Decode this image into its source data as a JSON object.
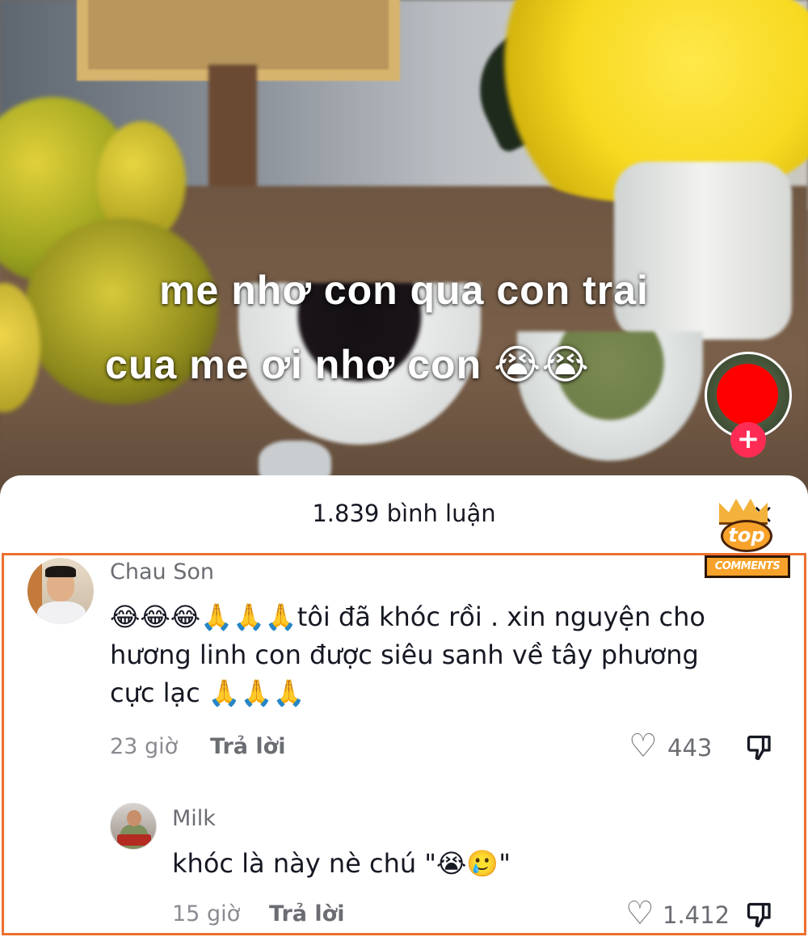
{
  "video": {
    "caption_line1": "me nhơ con qua con trai",
    "caption_line2": "cua me ơi  nhơ con 😭😭",
    "follow_symbol": "+"
  },
  "comments_panel": {
    "title": "1.839 bình luận",
    "close_symbol": "×"
  },
  "badge": {
    "top": "top",
    "comments": "COMMENTS"
  },
  "comments": [
    {
      "username": "Chau Son",
      "text": "😂😂😂🙏🙏🙏tôi đã khóc rồi . xin nguyện cho hương linh con được siêu sanh về tây phương cực lạc 🙏🙏🙏",
      "time": "23 giờ",
      "reply_label": "Trả lời",
      "likes": "443"
    },
    {
      "username": "Milk",
      "text": "khóc là này nè chú \"😭🥲\"",
      "time": "15 giờ",
      "reply_label": "Trả lời",
      "likes": "1.412"
    }
  ],
  "icons": {
    "like": "heart-outline-icon",
    "dislike": "thumbs-down-icon",
    "follow": "plus-icon",
    "close": "close-icon"
  },
  "colors": {
    "highlight_border": "#ee6f2d",
    "follow_button": "#fe2c55",
    "badge_orange": "#f7a22a"
  }
}
